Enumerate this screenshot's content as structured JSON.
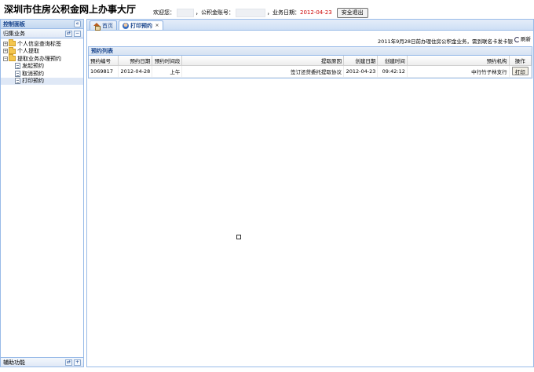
{
  "header": {
    "title": "深圳市住房公积金网上办事大厅",
    "welcome": "欢迎您：",
    "account_label": "，公积金账号：",
    "date_label": "，业务日期：",
    "business_date": "2012-04-23",
    "logout_label": "安全退出"
  },
  "sidebar": {
    "panel_title": "控制面板",
    "collapse_glyph": "«",
    "section_title": "归集业务",
    "items": [
      {
        "label": "个人信息查询标签",
        "expander": "+"
      },
      {
        "label": "个人提取",
        "expander": "+"
      },
      {
        "label": "提取业务办理预约",
        "expander": "−"
      }
    ],
    "children": [
      {
        "label": "发起预约"
      },
      {
        "label": "取消预约"
      },
      {
        "label": "打印预约"
      }
    ],
    "bottom_title": "辅助功能",
    "mini_glyphs": [
      "⇄",
      "+"
    ]
  },
  "tabs": [
    {
      "label": "首页"
    },
    {
      "label": "打印预约",
      "close": "×"
    }
  ],
  "toolbar": {
    "notice": "2011年9月28日前办理住房公积金业务，需到联名卡发卡银",
    "refresh_label": "刷新"
  },
  "grid": {
    "title": "预约列表",
    "columns": [
      "预约编号",
      "预约日期",
      "预约时间段",
      "提取原因",
      "创建日期",
      "创建时间",
      "预约机构",
      "操作"
    ],
    "rows": [
      {
        "id": "1069817",
        "date": "2012-04-28",
        "period": "上午",
        "reason": "签订还贷委托提取协议",
        "created_date": "2012-04-23",
        "created_time": "09:42:12",
        "branch": "中行竹子林支行",
        "action": "打印"
      }
    ]
  },
  "colors": {
    "border_blue": "#99bbe8",
    "header_text_blue": "#15428b",
    "date_red": "#cc0000",
    "selected_row": "#dfe8f6"
  }
}
